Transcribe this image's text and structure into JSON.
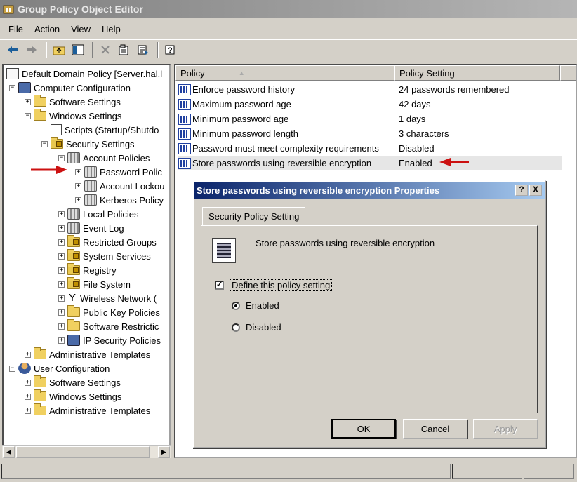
{
  "window": {
    "title": "Group Policy Object Editor"
  },
  "menu": {
    "items": [
      {
        "label": "File"
      },
      {
        "label": "Action"
      },
      {
        "label": "View"
      },
      {
        "label": "Help"
      }
    ]
  },
  "toolbar": {
    "buttons": [
      "back-arrow-icon",
      "forward-arrow-icon",
      "up-folder-icon",
      "show-hide-tree-icon",
      "delete-icon",
      "properties-icon",
      "export-list-icon",
      "help-icon"
    ]
  },
  "tree": {
    "items": [
      {
        "label": "Default Domain Policy [Server.hal.l"
      },
      {
        "label": "Computer Configuration"
      },
      {
        "label": "Software Settings"
      },
      {
        "label": "Windows Settings"
      },
      {
        "label": "Scripts (Startup/Shutdo"
      },
      {
        "label": "Security Settings"
      },
      {
        "label": "Account Policies"
      },
      {
        "label": "Password Polic"
      },
      {
        "label": "Account Lockou"
      },
      {
        "label": "Kerberos Policy"
      },
      {
        "label": "Local Policies"
      },
      {
        "label": "Event Log"
      },
      {
        "label": "Restricted Groups"
      },
      {
        "label": "System Services"
      },
      {
        "label": "Registry"
      },
      {
        "label": "File System"
      },
      {
        "label": "Wireless Network ("
      },
      {
        "label": "Public Key Policies"
      },
      {
        "label": "Software Restrictic"
      },
      {
        "label": "IP Security Policies"
      },
      {
        "label": "Administrative Templates"
      },
      {
        "label": "User Configuration"
      },
      {
        "label": "Software Settings"
      },
      {
        "label": "Windows Settings"
      },
      {
        "label": "Administrative Templates"
      }
    ]
  },
  "list": {
    "columns": [
      "Policy",
      "Policy Setting"
    ],
    "rows": [
      {
        "policy": "Enforce password history",
        "setting": "24 passwords remembered"
      },
      {
        "policy": "Maximum password age",
        "setting": "42 days"
      },
      {
        "policy": "Minimum password age",
        "setting": "1 days"
      },
      {
        "policy": "Minimum password length",
        "setting": "3 characters"
      },
      {
        "policy": "Password must meet complexity requirements",
        "setting": "Disabled"
      },
      {
        "policy": "Store passwords using reversible encryption",
        "setting": "Enabled"
      }
    ]
  },
  "dialog": {
    "title": "Store passwords using reversible encryption Properties",
    "help_btn": "?",
    "close_btn": "X",
    "tab": "Security Policy Setting",
    "description": "Store passwords using reversible encryption",
    "define_checkbox": {
      "label": "Define this policy setting",
      "checked": true
    },
    "radio_enabled": {
      "label": "Enabled",
      "selected": true
    },
    "radio_disabled": {
      "label": "Disabled",
      "selected": false
    },
    "buttons": {
      "ok": "OK",
      "cancel": "Cancel",
      "apply": "Apply"
    }
  },
  "colors": {
    "annotation_arrow": "#cc1111",
    "dialog_title_start": "#0a246a",
    "dialog_title_end": "#a6caf0"
  }
}
